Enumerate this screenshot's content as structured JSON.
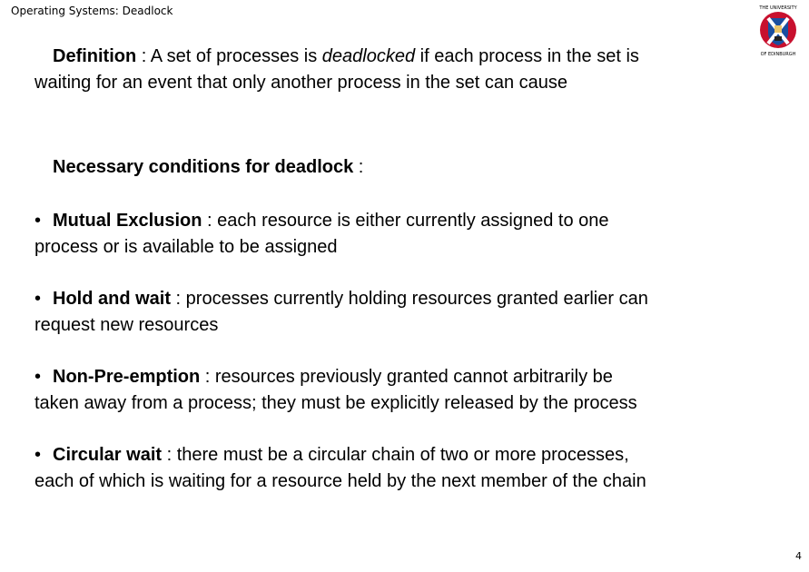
{
  "header": {
    "title": "Operating Systems: Deadlock"
  },
  "logo": {
    "text_top": "THE UNIVERSITY",
    "text_bottom": "OF EDINBURGH",
    "colors": {
      "ring": "#c8102e",
      "shield": "#1a4fa0",
      "saltire": "#ffffff"
    }
  },
  "definition": {
    "term": "Definition",
    "sep": " : ",
    "text_before": "A set of processes is ",
    "emphasis": "deadlocked",
    "text_after_line1": " if each process in the set is",
    "line2": "waiting for an event that only another process in the set can cause"
  },
  "conditions_heading": {
    "label": "Necessary conditions for deadlock",
    "sep": " :"
  },
  "conditions": [
    {
      "bullet": "•",
      "term": "Mutual Exclusion",
      "sep": " : ",
      "line1": "each resource is either currently assigned to one",
      "line2": "process or is available to be assigned"
    },
    {
      "bullet": "•",
      "term": "Hold and wait",
      "sep": " : ",
      "line1": "processes currently holding resources granted earlier can",
      "line2": "request new resources"
    },
    {
      "bullet": "•",
      "term": "Non-Pre-emption",
      "sep": " : ",
      "line1": "resources previously granted cannot arbitrarily be",
      "line2": "taken away from a process;  they must be explicitly released by the process"
    },
    {
      "bullet": "•",
      "term": "Circular wait",
      "sep": " : ",
      "line1": "there must be a circular chain of two or more processes,",
      "line2": "each of which is waiting for a resource held by the next member of the chain"
    }
  ],
  "footer": {
    "page_number": "4"
  }
}
